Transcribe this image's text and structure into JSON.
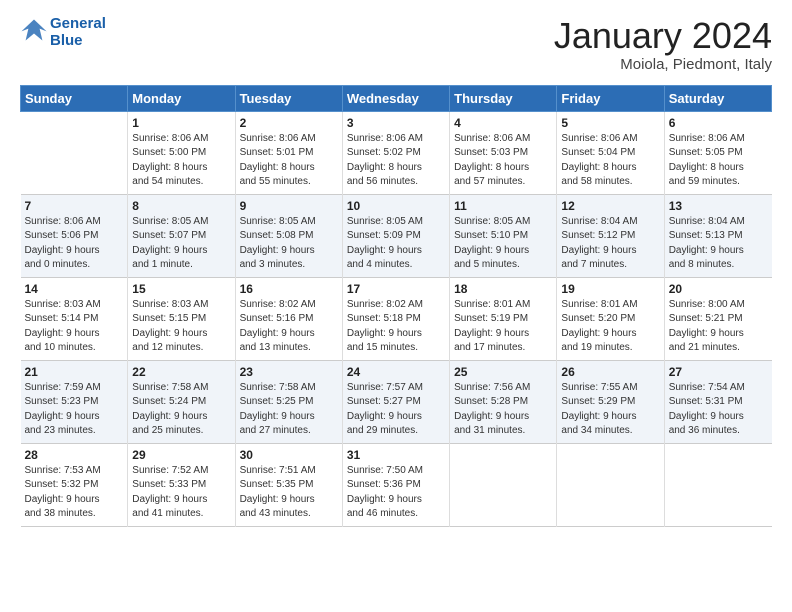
{
  "header": {
    "logo_line1": "General",
    "logo_line2": "Blue",
    "month": "January 2024",
    "location": "Moiola, Piedmont, Italy"
  },
  "weekdays": [
    "Sunday",
    "Monday",
    "Tuesday",
    "Wednesday",
    "Thursday",
    "Friday",
    "Saturday"
  ],
  "weeks": [
    [
      {
        "day": "",
        "info": ""
      },
      {
        "day": "1",
        "info": "Sunrise: 8:06 AM\nSunset: 5:00 PM\nDaylight: 8 hours\nand 54 minutes."
      },
      {
        "day": "2",
        "info": "Sunrise: 8:06 AM\nSunset: 5:01 PM\nDaylight: 8 hours\nand 55 minutes."
      },
      {
        "day": "3",
        "info": "Sunrise: 8:06 AM\nSunset: 5:02 PM\nDaylight: 8 hours\nand 56 minutes."
      },
      {
        "day": "4",
        "info": "Sunrise: 8:06 AM\nSunset: 5:03 PM\nDaylight: 8 hours\nand 57 minutes."
      },
      {
        "day": "5",
        "info": "Sunrise: 8:06 AM\nSunset: 5:04 PM\nDaylight: 8 hours\nand 58 minutes."
      },
      {
        "day": "6",
        "info": "Sunrise: 8:06 AM\nSunset: 5:05 PM\nDaylight: 8 hours\nand 59 minutes."
      }
    ],
    [
      {
        "day": "7",
        "info": "Sunrise: 8:06 AM\nSunset: 5:06 PM\nDaylight: 9 hours\nand 0 minutes."
      },
      {
        "day": "8",
        "info": "Sunrise: 8:05 AM\nSunset: 5:07 PM\nDaylight: 9 hours\nand 1 minute."
      },
      {
        "day": "9",
        "info": "Sunrise: 8:05 AM\nSunset: 5:08 PM\nDaylight: 9 hours\nand 3 minutes."
      },
      {
        "day": "10",
        "info": "Sunrise: 8:05 AM\nSunset: 5:09 PM\nDaylight: 9 hours\nand 4 minutes."
      },
      {
        "day": "11",
        "info": "Sunrise: 8:05 AM\nSunset: 5:10 PM\nDaylight: 9 hours\nand 5 minutes."
      },
      {
        "day": "12",
        "info": "Sunrise: 8:04 AM\nSunset: 5:12 PM\nDaylight: 9 hours\nand 7 minutes."
      },
      {
        "day": "13",
        "info": "Sunrise: 8:04 AM\nSunset: 5:13 PM\nDaylight: 9 hours\nand 8 minutes."
      }
    ],
    [
      {
        "day": "14",
        "info": "Sunrise: 8:03 AM\nSunset: 5:14 PM\nDaylight: 9 hours\nand 10 minutes."
      },
      {
        "day": "15",
        "info": "Sunrise: 8:03 AM\nSunset: 5:15 PM\nDaylight: 9 hours\nand 12 minutes."
      },
      {
        "day": "16",
        "info": "Sunrise: 8:02 AM\nSunset: 5:16 PM\nDaylight: 9 hours\nand 13 minutes."
      },
      {
        "day": "17",
        "info": "Sunrise: 8:02 AM\nSunset: 5:18 PM\nDaylight: 9 hours\nand 15 minutes."
      },
      {
        "day": "18",
        "info": "Sunrise: 8:01 AM\nSunset: 5:19 PM\nDaylight: 9 hours\nand 17 minutes."
      },
      {
        "day": "19",
        "info": "Sunrise: 8:01 AM\nSunset: 5:20 PM\nDaylight: 9 hours\nand 19 minutes."
      },
      {
        "day": "20",
        "info": "Sunrise: 8:00 AM\nSunset: 5:21 PM\nDaylight: 9 hours\nand 21 minutes."
      }
    ],
    [
      {
        "day": "21",
        "info": "Sunrise: 7:59 AM\nSunset: 5:23 PM\nDaylight: 9 hours\nand 23 minutes."
      },
      {
        "day": "22",
        "info": "Sunrise: 7:58 AM\nSunset: 5:24 PM\nDaylight: 9 hours\nand 25 minutes."
      },
      {
        "day": "23",
        "info": "Sunrise: 7:58 AM\nSunset: 5:25 PM\nDaylight: 9 hours\nand 27 minutes."
      },
      {
        "day": "24",
        "info": "Sunrise: 7:57 AM\nSunset: 5:27 PM\nDaylight: 9 hours\nand 29 minutes."
      },
      {
        "day": "25",
        "info": "Sunrise: 7:56 AM\nSunset: 5:28 PM\nDaylight: 9 hours\nand 31 minutes."
      },
      {
        "day": "26",
        "info": "Sunrise: 7:55 AM\nSunset: 5:29 PM\nDaylight: 9 hours\nand 34 minutes."
      },
      {
        "day": "27",
        "info": "Sunrise: 7:54 AM\nSunset: 5:31 PM\nDaylight: 9 hours\nand 36 minutes."
      }
    ],
    [
      {
        "day": "28",
        "info": "Sunrise: 7:53 AM\nSunset: 5:32 PM\nDaylight: 9 hours\nand 38 minutes."
      },
      {
        "day": "29",
        "info": "Sunrise: 7:52 AM\nSunset: 5:33 PM\nDaylight: 9 hours\nand 41 minutes."
      },
      {
        "day": "30",
        "info": "Sunrise: 7:51 AM\nSunset: 5:35 PM\nDaylight: 9 hours\nand 43 minutes."
      },
      {
        "day": "31",
        "info": "Sunrise: 7:50 AM\nSunset: 5:36 PM\nDaylight: 9 hours\nand 46 minutes."
      },
      {
        "day": "",
        "info": ""
      },
      {
        "day": "",
        "info": ""
      },
      {
        "day": "",
        "info": ""
      }
    ]
  ]
}
